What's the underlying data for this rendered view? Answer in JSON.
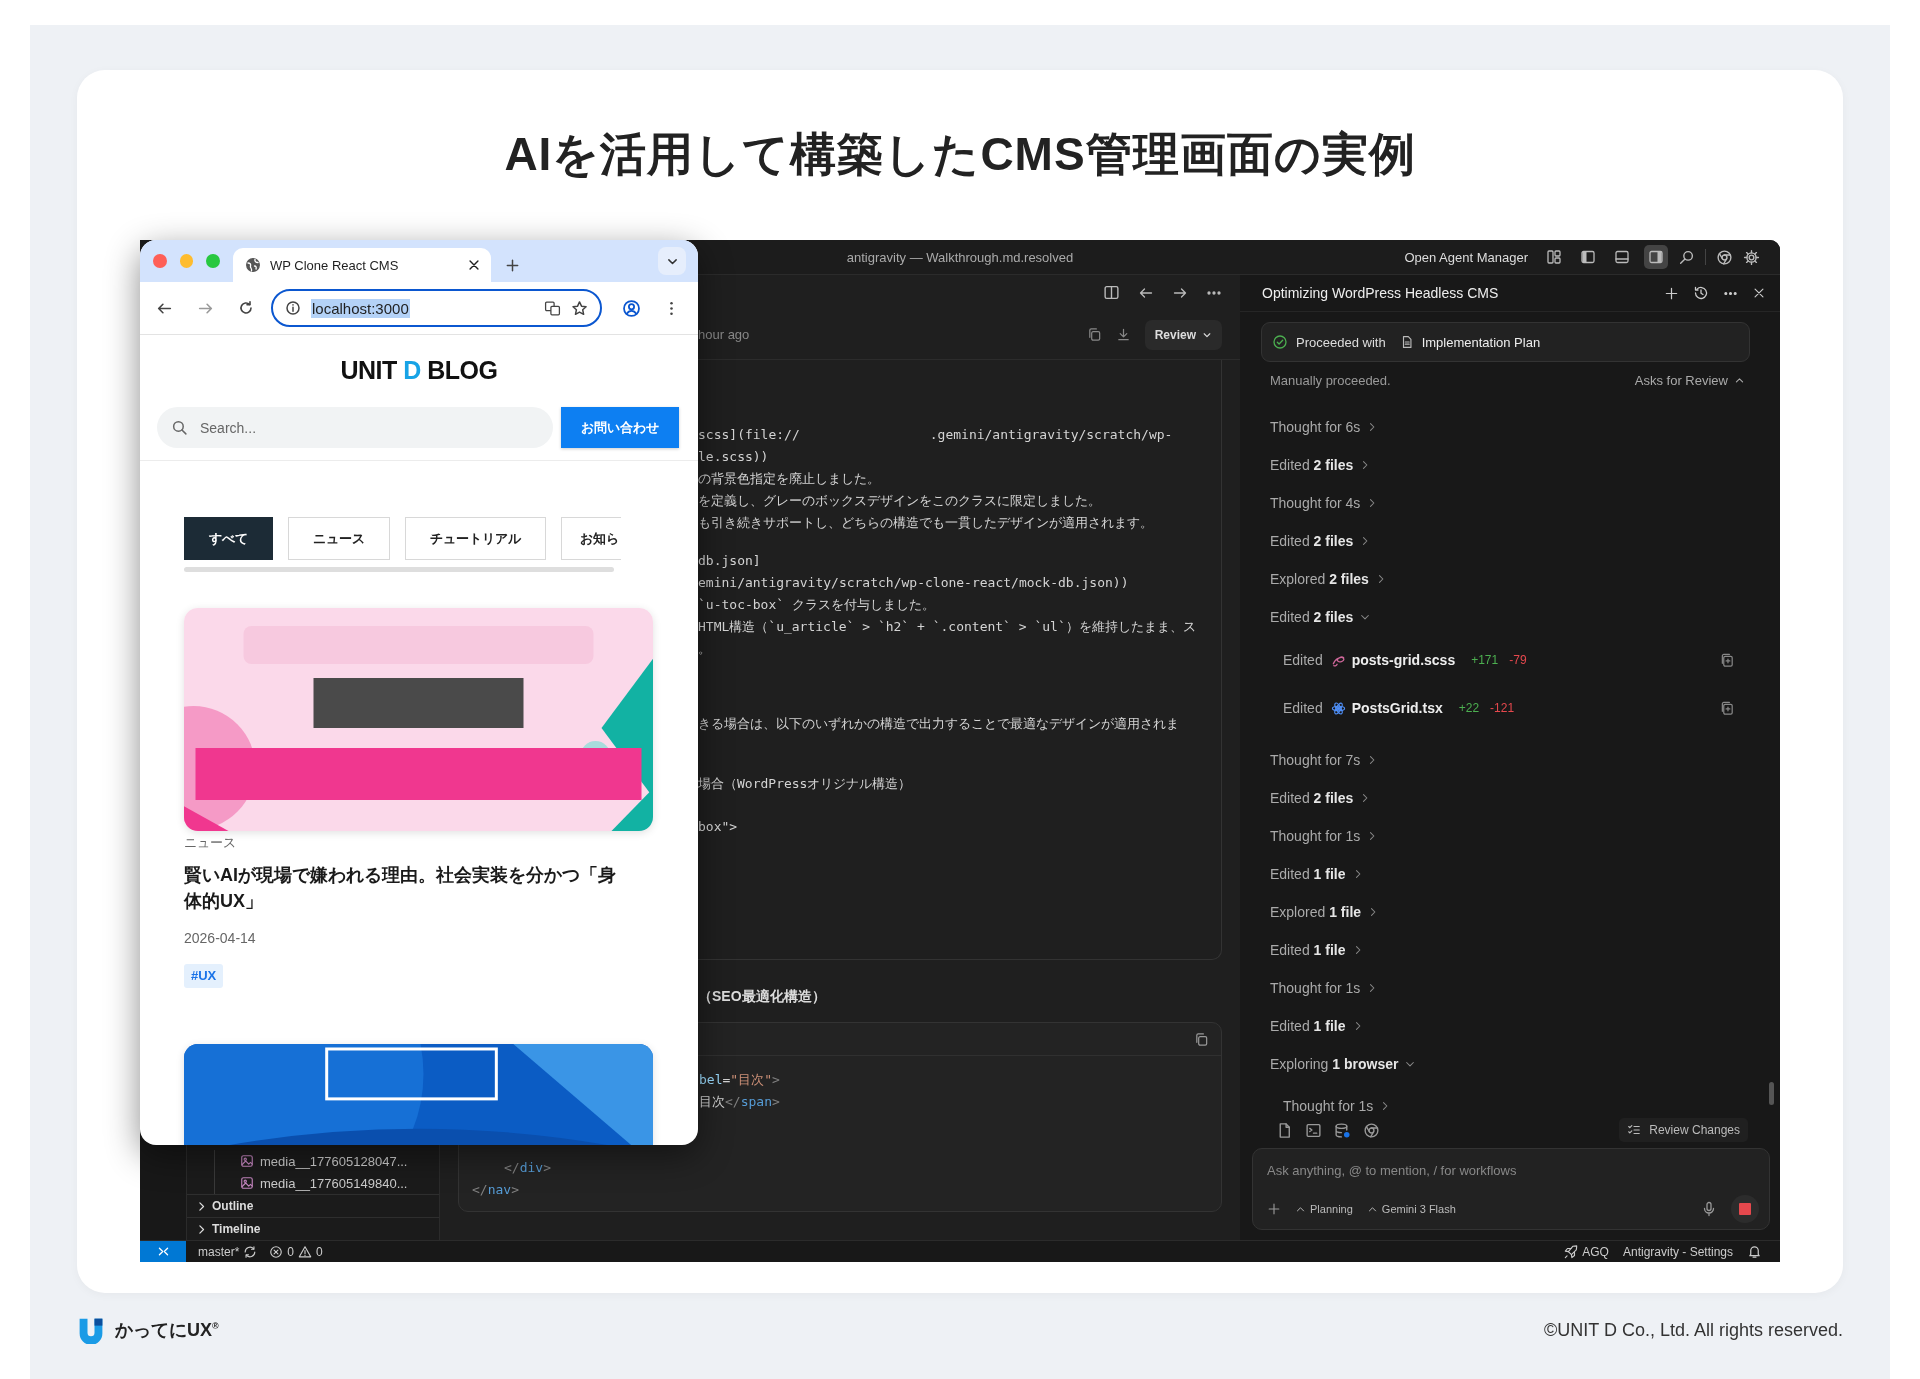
{
  "page": {
    "title": "AIを活用して構築したCMS管理画面の実例"
  },
  "browser": {
    "tab_title": "WP Clone React CMS",
    "url": "localhost:3000",
    "url_selected": true,
    "blog": {
      "logo": [
        {
          "text": "UNIT",
          "accent": false
        },
        {
          "text": "D",
          "accent": true
        },
        {
          "text": "BLOG",
          "accent": false
        }
      ],
      "search_placeholder": "Search...",
      "contact_button": "お問い合わせ",
      "categories": [
        {
          "label": "すべて",
          "selected": true
        },
        {
          "label": "ニュース",
          "selected": false
        },
        {
          "label": "チュートリアル",
          "selected": false
        },
        {
          "label": "お知ら",
          "selected": false
        }
      ],
      "posts": [
        {
          "image": {
            "kind": "picture"
          },
          "category": "ニュース",
          "title": "賢いAIが現場で嫌われる理由。社会実装を分かつ「身体的UX」",
          "date": "2026-04-14",
          "tags": [
            "#UX"
          ]
        },
        {
          "image": {
            "kind": "picture"
          }
        }
      ]
    }
  },
  "ide": {
    "window_title": "antigravity — Walkthrough.md.resolved",
    "agent_manager": "Open Agent Manager",
    "layout_buttons": [
      {
        "kind": "grid",
        "selected": false
      },
      {
        "kind": "sidebar-left",
        "selected": false
      },
      {
        "kind": "panel-bottom",
        "selected": false
      },
      {
        "kind": "sidebar-right",
        "selected": true
      }
    ],
    "explorer": {
      "files": [
        "media__177605128047...",
        "media__177605149840..."
      ],
      "sections": [
        {
          "label": "Outline",
          "expanded": false
        },
        {
          "label": "Timeline",
          "expanded": false
        }
      ]
    },
    "editor": {
      "doc_time": "hour ago",
      "review_button": "Review",
      "blocks": [
        {
          "lines": [
            [
              "scss](file://",
              ".gemini/antigravity/scratch/wp-"
            ],
            [
              "le.scss))"
            ],
            [
              "の背景色指定を廃止しました。"
            ],
            [
              "を定義し、グレーのボックスデザインをこのクラスに限定しました。"
            ],
            [
              "も引き続きサポートし、どちらの構造でも一貫したデザインが適用されます。"
            ]
          ]
        },
        {
          "lines": [
            [
              "db.json]"
            ],
            [
              "emini/antigravity/scratch/wp-clone-react/mock-db.json))"
            ],
            [
              "`u-toc-box` クラスを付与しました。"
            ],
            [
              "HTML構造（`u_article` > `h2` + `.content` > `ul`）を維持したまま、ス"
            ],
            [
              "。"
            ]
          ]
        },
        {
          "lines": [
            [
              "きる場合は、以下のいずれかの構造で出力することで最適なデザインが適用されま"
            ]
          ]
        },
        {
          "lines": [
            [
              "場合（WordPressオリジナル構造）"
            ]
          ]
        },
        {
          "lines": [
            [
              "box\">"
            ]
          ]
        }
      ],
      "heading": "（SEO最適化構造）",
      "code_lines": [
        {
          "tokens": [
            {
              "text": "bel",
              "kind": "attr"
            },
            {
              "text": "=",
              "kind": "punct"
            },
            {
              "text": "\"目次\"",
              "kind": "string"
            },
            {
              "text": ">",
              "kind": "bracket"
            }
          ]
        },
        {
          "tokens": [
            {
              "text": "目次",
              "kind": "text"
            },
            {
              "text": "</",
              "kind": "bracket"
            },
            {
              "text": "span",
              "kind": "tag"
            },
            {
              "text": ">",
              "kind": "bracket"
            }
          ]
        },
        {
          "tokens": [
            {
              "text": "</",
              "kind": "bracket"
            },
            {
              "text": "div",
              "kind": "tag"
            },
            {
              "text": ">",
              "kind": "bracket"
            }
          ]
        },
        {
          "tokens": [
            {
              "text": "</",
              "kind": "bracket"
            },
            {
              "text": "nav",
              "kind": "tag"
            },
            {
              "text": ">",
              "kind": "bracket"
            }
          ]
        }
      ]
    },
    "agent": {
      "title": "Optimizing WordPress Headless CMS",
      "plan_status": "Proceeded with",
      "plan_doc": "Implementation Plan",
      "note": "Manually proceeded.",
      "review_toggle": {
        "label": "Asks for Review",
        "expanded": true
      },
      "steps": [
        {
          "kind": "thought",
          "label": "Thought for 6s",
          "expanded": false
        },
        {
          "kind": "action",
          "verb": "Edited",
          "detail": "2 files",
          "expanded": false
        },
        {
          "kind": "thought",
          "label": "Thought for 4s",
          "expanded": false
        },
        {
          "kind": "action",
          "verb": "Edited",
          "detail": "2 files",
          "expanded": false
        },
        {
          "kind": "action",
          "verb": "Explored",
          "detail": "2 files",
          "expanded": false
        },
        {
          "kind": "action",
          "verb": "Edited",
          "detail": "2 files",
          "expanded": true,
          "children": [
            {
              "kind": "scss",
              "verb": "Edited",
              "file": "posts-grid.scss",
              "added": "+171",
              "removed": "-79"
            },
            {
              "kind": "react",
              "verb": "Edited",
              "file": "PostsGrid.tsx",
              "added": "+22",
              "removed": "-121"
            }
          ]
        },
        {
          "kind": "thought",
          "label": "Thought for 7s",
          "expanded": false
        },
        {
          "kind": "action",
          "verb": "Edited",
          "detail": "2 files",
          "expanded": false
        },
        {
          "kind": "thought",
          "label": "Thought for 1s",
          "expanded": false
        },
        {
          "kind": "action",
          "verb": "Edited",
          "detail": "1 file",
          "expanded": false
        },
        {
          "kind": "action",
          "verb": "Explored",
          "detail": "1 file",
          "expanded": false
        },
        {
          "kind": "action",
          "verb": "Edited",
          "detail": "1 file",
          "expanded": false
        },
        {
          "kind": "thought",
          "label": "Thought for 1s",
          "expanded": false
        },
        {
          "kind": "action",
          "verb": "Edited",
          "detail": "1 file",
          "expanded": false
        },
        {
          "kind": "action",
          "verb": "Exploring",
          "detail": "1 browser",
          "expanded": true,
          "children": [
            {
              "kind": "thought",
              "label": "Thought for 1s",
              "expanded": false
            }
          ]
        }
      ],
      "review_changes": "Review Changes",
      "input": {
        "placeholder": "Ask anything, @ to mention, / for workflows",
        "mode": "Planning",
        "model": "Gemini 3 Flash"
      }
    },
    "status_bar": {
      "branch": "master*",
      "errors": "0",
      "warnings": "0",
      "account": "AGQ",
      "settings": "Antigravity - Settings"
    }
  },
  "footer": {
    "brand": "かってにUX$^{®}$",
    "copyright": "©UNIT D Co., Ltd. All rights reserved."
  }
}
